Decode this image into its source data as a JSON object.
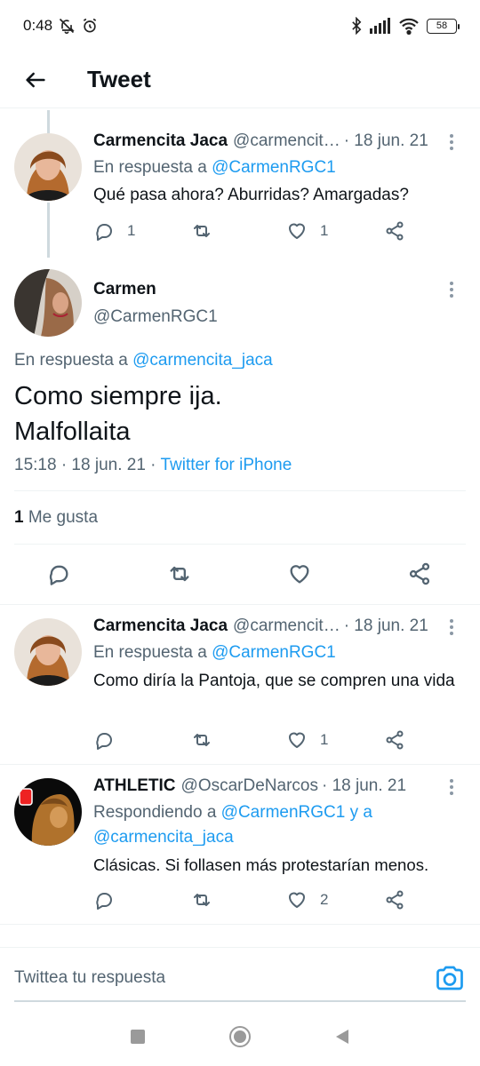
{
  "status": {
    "time": "0:48",
    "battery": "58",
    "icons": [
      "bell-off-icon",
      "alarm-icon",
      "bluetooth-icon",
      "signal-icon",
      "wifi-icon",
      "battery-icon"
    ]
  },
  "header": {
    "title": "Tweet",
    "back_icon": "arrow-left-icon"
  },
  "tweets": [
    {
      "name": "Carmencita Jaca",
      "handle": "@carmencit…",
      "date": "· 18 jun. 21",
      "reply_prefix": "En respuesta a",
      "reply_to": "@CarmenRGC1",
      "text": "Qué pasa ahora? Aburridas? Amargadas?",
      "reply_count": "1",
      "retweet_count": "",
      "like_count": "1"
    },
    {
      "name": "Carmencita Jaca",
      "handle": "@carmencit…",
      "date": "· 18 jun. 21",
      "reply_prefix": "En respuesta a",
      "reply_to": "@CarmenRGC1",
      "text": "Como diría la Pantoja, que se compren una vida",
      "reply_count": "",
      "retweet_count": "",
      "like_count": "1"
    },
    {
      "name": "ATHLETIC",
      "handle": "@OscarDeNarcos",
      "date": "· 18 jun. 21",
      "reply_prefix": "Respondiendo a",
      "reply_to": "@CarmenRGC1 y a",
      "reply_to_2": "@carmencita_jaca",
      "text": "Clásicas. Si follasen más protestarían menos.",
      "reply_count": "",
      "retweet_count": "",
      "like_count": "2"
    }
  ],
  "main_tweet": {
    "name": "Carmen",
    "handle": "@CarmenRGC1",
    "reply_prefix": "En respuesta a",
    "reply_to": "@carmencita_jaca",
    "text_line1": "Como siempre ija.",
    "text_line2": "Malfollaita",
    "timestamp": "15:18 · 18 jun. 21 ·",
    "source": "Twitter for iPhone",
    "likes_count": "1",
    "likes_label": "Me gusta"
  },
  "reply_bar": {
    "placeholder": "Twittea tu respuesta",
    "camera_icon": "camera-icon"
  },
  "colors": {
    "accent": "#1d9bf0",
    "text": "#0f1419",
    "muted": "#536471",
    "divider": "#eff3f4"
  }
}
